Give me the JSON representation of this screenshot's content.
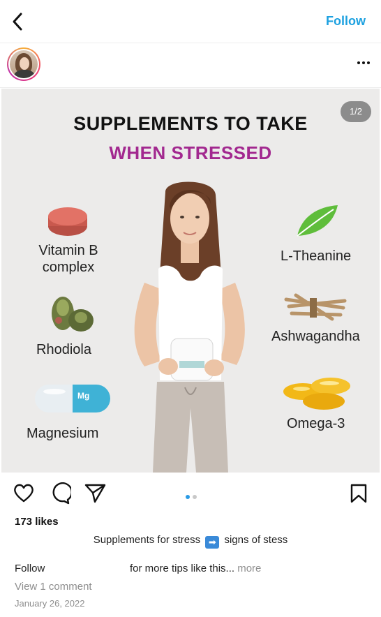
{
  "header": {
    "follow_label": "Follow"
  },
  "post": {
    "slide_counter": "1/2",
    "headline_line1": "SUPPLEMENTS TO TAKE",
    "headline_line2": "WHEN STRESSED",
    "supplements_left": [
      {
        "label_line1": "Vitamin B",
        "label_line2": "complex",
        "icon": "pill-icon"
      },
      {
        "label_line1": "Rhodiola",
        "icon": "rhodiola-plant-icon"
      },
      {
        "label_line1": "Magnesium",
        "icon": "magnesium-capsule-icon",
        "capsule_text": "Mg"
      }
    ],
    "supplements_right": [
      {
        "label_line1": "L-Theanine",
        "icon": "leaf-icon"
      },
      {
        "label_line1": "Ashwagandha",
        "icon": "root-bundle-icon"
      },
      {
        "label_line1": "Omega-3",
        "icon": "softgel-icon"
      }
    ],
    "colors": {
      "headline_accent": "#a2288f",
      "follow_blue": "#1da1e0",
      "dot_active": "#2a9be5"
    }
  },
  "actions": {
    "icons": [
      "heart-icon",
      "comment-icon",
      "share-icon",
      "bookmark-icon"
    ],
    "carousel_index": 1,
    "carousel_count": 2
  },
  "likes": "173 likes",
  "caption": {
    "part1": "Supplements for stress",
    "emoji": "➡",
    "part2": "signs of stess"
  },
  "follow_line": {
    "follow": "Follow",
    "tips": "for more tips like this...",
    "more": "more"
  },
  "comments": "View 1 comment",
  "date": "January 26, 2022"
}
